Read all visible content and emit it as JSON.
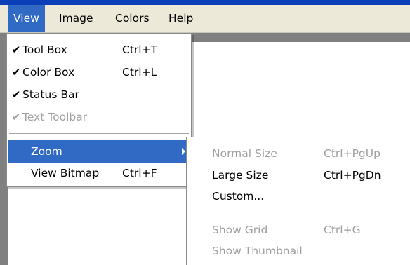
{
  "menubar": {
    "items": [
      {
        "label": "View",
        "active": true
      },
      {
        "label": "Image",
        "active": false
      },
      {
        "label": "Colors",
        "active": false
      },
      {
        "label": "Help",
        "active": false
      }
    ]
  },
  "view_menu": {
    "items": [
      {
        "checked": true,
        "label": "Tool Box",
        "shortcut": "Ctrl+T",
        "enabled": true
      },
      {
        "checked": true,
        "label": "Color Box",
        "shortcut": "Ctrl+L",
        "enabled": true
      },
      {
        "checked": true,
        "label": "Status Bar",
        "shortcut": "",
        "enabled": true
      },
      {
        "checked": true,
        "label": "Text Toolbar",
        "shortcut": "",
        "enabled": false
      },
      {
        "label": "Zoom",
        "has_submenu": true,
        "highlighted": true,
        "enabled": true
      },
      {
        "label": "View Bitmap",
        "shortcut": "Ctrl+F",
        "enabled": true
      }
    ],
    "check_glyph": "✔"
  },
  "zoom_menu": {
    "items": [
      {
        "label": "Normal Size",
        "shortcut": "Ctrl+PgUp",
        "enabled": false
      },
      {
        "label": "Large Size",
        "shortcut": "Ctrl+PgDn",
        "enabled": true
      },
      {
        "label": "Custom...",
        "shortcut": "",
        "enabled": true
      },
      {
        "label": "Show Grid",
        "shortcut": "Ctrl+G",
        "enabled": false
      },
      {
        "label": "Show Thumbnail",
        "shortcut": "",
        "enabled": false
      }
    ]
  },
  "colors": {
    "highlight": "#316ac5",
    "menubar_bg": "#ece9d8",
    "disabled_text": "#a0a0a0",
    "workspace_gray": "#808080"
  }
}
